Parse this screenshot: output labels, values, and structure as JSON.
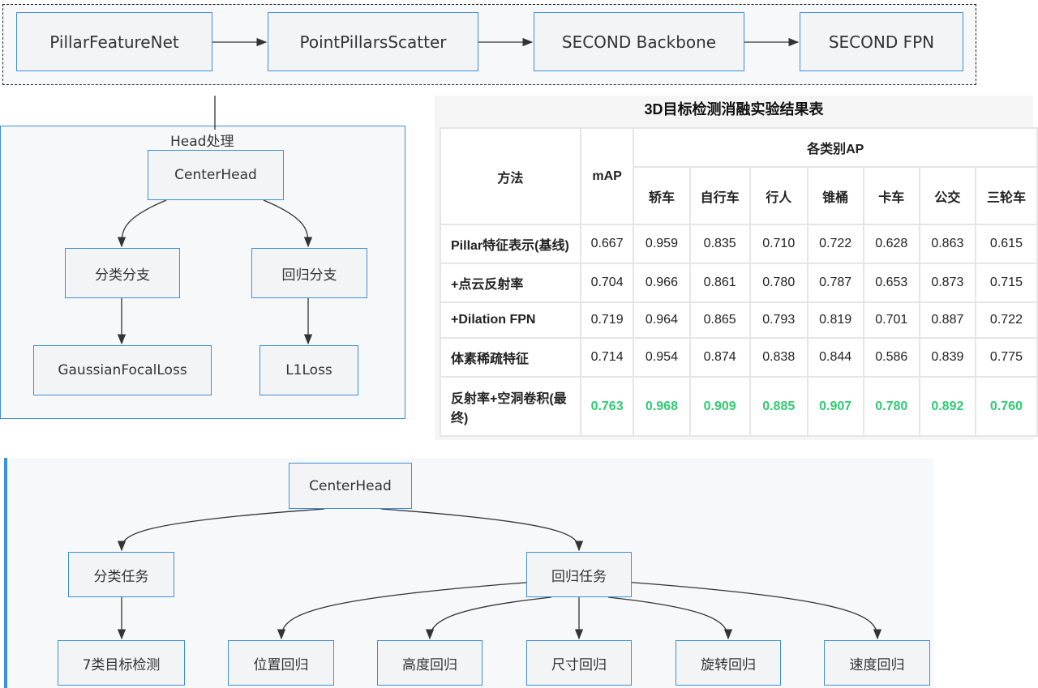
{
  "pipeline": {
    "nodes": [
      "PillarFeatureNet",
      "PointPillarsScatter",
      "SECOND Backbone",
      "SECOND FPN"
    ]
  },
  "head": {
    "label": "Head处理",
    "center": "CenterHead",
    "cls_branch": "分类分支",
    "reg_branch": "回归分支",
    "cls_loss": "GaussianFocalLoss",
    "reg_loss": "L1Loss"
  },
  "table": {
    "title": "3D目标检测消融实验结果表",
    "headers": {
      "method": "方法",
      "map": "mAP",
      "group": "各类别AP",
      "classes": [
        "轿车",
        "自行车",
        "行人",
        "锥桶",
        "卡车",
        "公交",
        "三轮车"
      ]
    },
    "rows": [
      {
        "method": "Pillar特征表示(基线)",
        "values": [
          "0.667",
          "0.959",
          "0.835",
          "0.710",
          "0.722",
          "0.628",
          "0.863",
          "0.615"
        ]
      },
      {
        "method": "+点云反射率",
        "values": [
          "0.704",
          "0.966",
          "0.861",
          "0.780",
          "0.787",
          "0.653",
          "0.873",
          "0.715"
        ]
      },
      {
        "method": "+Dilation FPN",
        "values": [
          "0.719",
          "0.964",
          "0.865",
          "0.793",
          "0.819",
          "0.701",
          "0.887",
          "0.722"
        ]
      },
      {
        "method": "体素稀疏特征",
        "values": [
          "0.714",
          "0.954",
          "0.874",
          "0.838",
          "0.844",
          "0.586",
          "0.839",
          "0.775"
        ]
      },
      {
        "method": "反射率+空洞卷积(最终)",
        "values": [
          "0.763",
          "0.968",
          "0.909",
          "0.885",
          "0.907",
          "0.780",
          "0.892",
          "0.760"
        ],
        "highlight": true
      }
    ],
    "highlight_color": "#2ecc71"
  },
  "tasks": {
    "center": "CenterHead",
    "cls": "分类任务",
    "reg": "回归任务",
    "cls_out": "7类目标检测",
    "reg_outs": [
      "位置回归",
      "高度回归",
      "尺寸回归",
      "旋转回归",
      "速度回归"
    ]
  },
  "colors": {
    "node_border": "#3f8fd6",
    "accent": "#3a94d8"
  }
}
